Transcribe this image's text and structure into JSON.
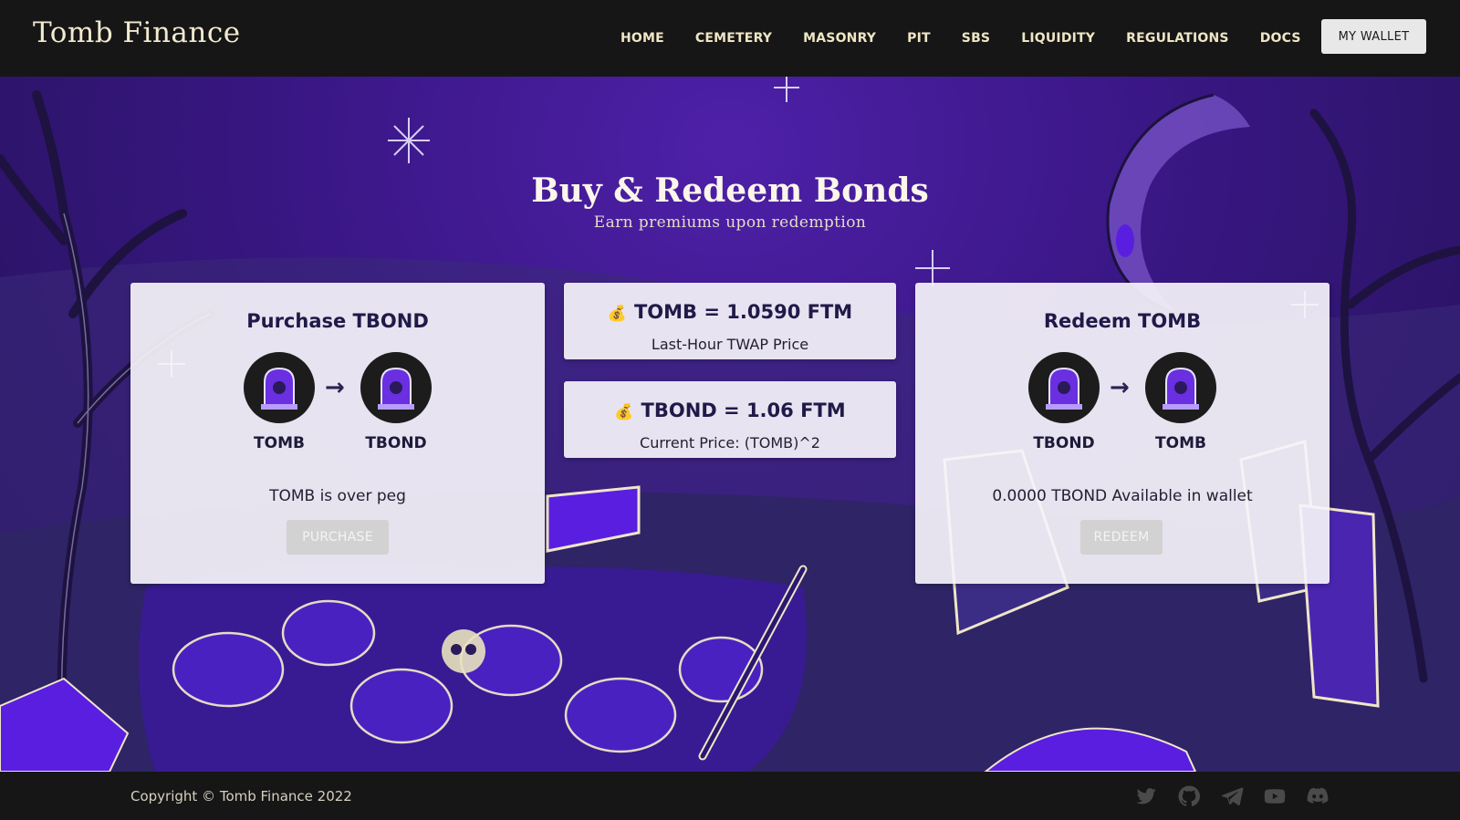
{
  "header": {
    "brand": "Tomb Finance",
    "nav": [
      "HOME",
      "CEMETERY",
      "MASONRY",
      "PIT",
      "SBS",
      "LIQUIDITY",
      "REGULATIONS",
      "DOCS"
    ],
    "wallet_button": "MY WALLET"
  },
  "hero": {
    "title": "Buy & Redeem Bonds",
    "subtitle": "Earn premiums upon redemption"
  },
  "purchase": {
    "title": "Purchase TBOND",
    "from_token": "TOMB",
    "to_token": "TBOND",
    "status": "TOMB is over peg",
    "button": "PURCHASE"
  },
  "prices": {
    "tomb": {
      "value": "TOMB = 1.0590 FTM",
      "caption": "Last-Hour TWAP Price"
    },
    "tbond": {
      "value": "TBOND = 1.06 FTM",
      "caption": "Current Price: (TOMB)^2"
    }
  },
  "redeem": {
    "title": "Redeem TOMB",
    "from_token": "TBOND",
    "to_token": "TOMB",
    "status": "0.0000 TBOND Available in wallet",
    "button": "REDEEM"
  },
  "footer": {
    "copyright": "Copyright © Tomb Finance 2022",
    "social_icons": [
      "twitter-icon",
      "github-icon",
      "telegram-icon",
      "youtube-icon",
      "discord-icon"
    ]
  },
  "colors": {
    "header_bg": "#161616",
    "accent_purple": "#5a1ee0",
    "card_bg": "#f6f4fa",
    "disabled_button": "#d2d2d2"
  }
}
